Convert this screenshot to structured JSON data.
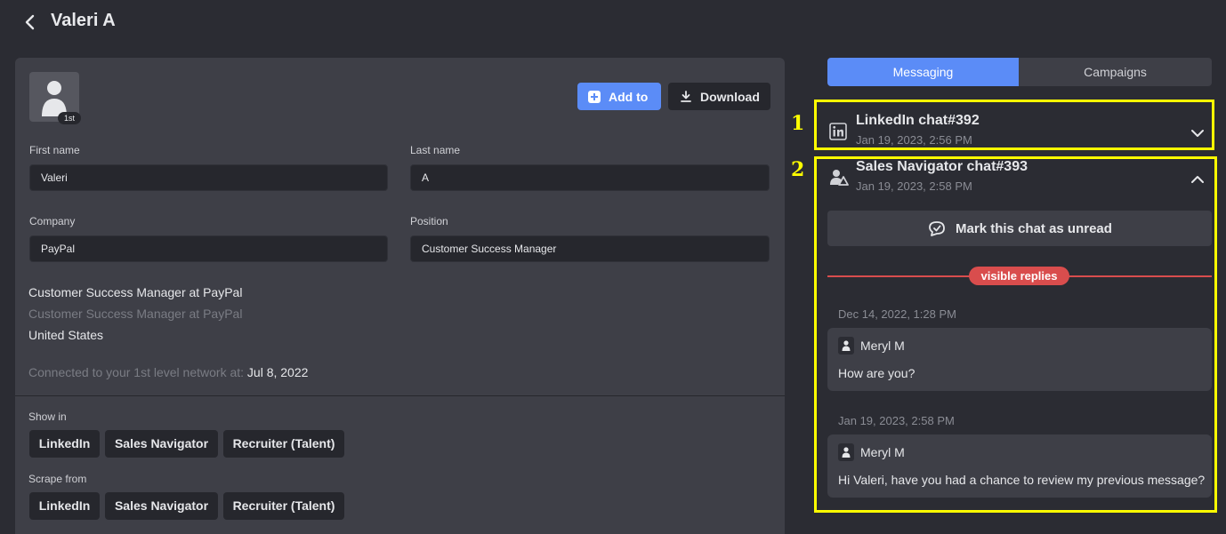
{
  "header": {
    "title": "Valeri A"
  },
  "profile": {
    "degree_badge": "1st",
    "add_to_label": "Add to",
    "download_label": "Download",
    "fields": {
      "first_name_label": "First name",
      "first_name_value": "Valeri",
      "last_name_label": "Last name",
      "last_name_value": "A",
      "company_label": "Company",
      "company_value": "PayPal",
      "position_label": "Position",
      "position_value": "Customer Success Manager"
    },
    "headline": "Customer Success Manager at PayPal",
    "headline_secondary": "Customer Success Manager at PayPal",
    "location": "United States",
    "connected_label": "Connected to your 1st level network at:",
    "connected_date": "Jul 8, 2022",
    "show_in_label": "Show in",
    "show_in_chips": [
      "LinkedIn",
      "Sales Navigator",
      "Recruiter (Talent)"
    ],
    "scrape_from_label": "Scrape from",
    "scrape_from_chips": [
      "LinkedIn",
      "Sales Navigator",
      "Recruiter (Talent)"
    ]
  },
  "tabs": [
    {
      "label": "Messaging",
      "active": true
    },
    {
      "label": "Campaigns",
      "active": false
    }
  ],
  "annotations": [
    "1",
    "2"
  ],
  "chats": [
    {
      "title": "LinkedIn chat#392",
      "date": "Jan 19, 2023, 2:56 PM",
      "icon": "linkedin-icon",
      "expanded": false
    },
    {
      "title": "Sales Navigator chat#393",
      "date": "Jan 19, 2023, 2:58 PM",
      "icon": "sales-navigator-icon",
      "expanded": true
    }
  ],
  "thread": {
    "mark_unread_label": "Mark this chat as unread",
    "visible_replies_label": "visible replies",
    "messages": [
      {
        "date": "Dec 14, 2022, 1:28 PM",
        "sender": "Meryl M",
        "text": "How are you?"
      },
      {
        "date": "Jan 19, 2023, 2:58 PM",
        "sender": "Meryl M",
        "text": "Hi Valeri, have you had a chance to review my previous message?"
      }
    ]
  },
  "colors": {
    "accent": "#5b8cf7",
    "background": "#2b2c33",
    "card": "#3e3f47",
    "highlight": "#ffff00",
    "replies_divider": "#d94d4d"
  }
}
